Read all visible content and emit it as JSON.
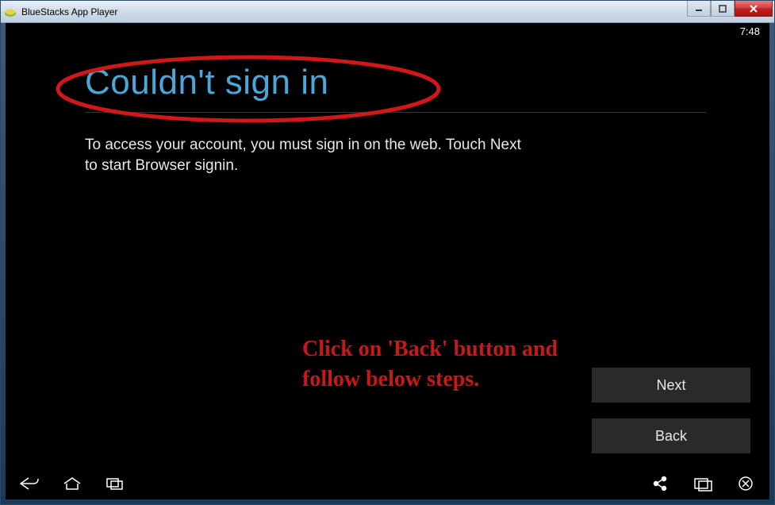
{
  "window": {
    "title": "BlueStacks App Player"
  },
  "statusbar": {
    "time": "7:48"
  },
  "screen": {
    "heading": "Couldn't sign in",
    "body": "To access your account, you must sign in on the web. Touch Next to start Browser signin."
  },
  "buttons": {
    "next": "Next",
    "back": "Back"
  },
  "annotations": {
    "instruction": "Click on 'Back' button and follow below steps."
  }
}
